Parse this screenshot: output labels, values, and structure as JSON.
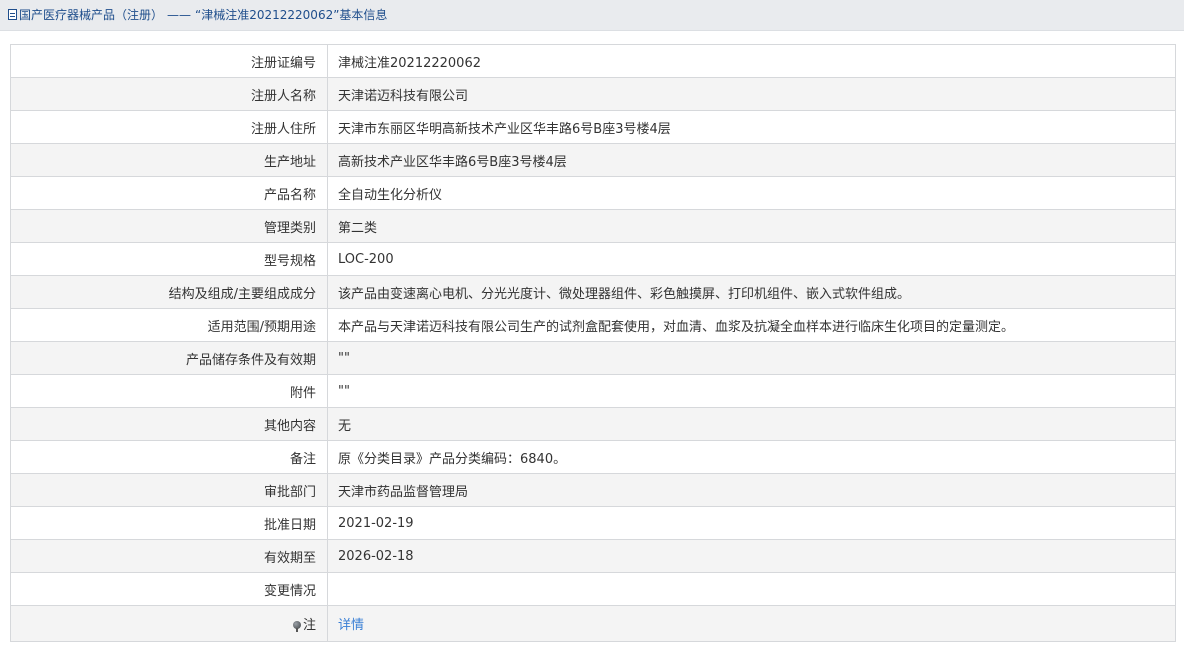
{
  "header": {
    "category": "国产医疗器械产品（注册）",
    "separator": "——",
    "title": "“津械注准20212220062”基本信息"
  },
  "rows": [
    {
      "label": "注册证编号",
      "value": "津械注准20212220062"
    },
    {
      "label": "注册人名称",
      "value": "天津诺迈科技有限公司"
    },
    {
      "label": "注册人住所",
      "value": "天津市东丽区华明高新技术产业区华丰路6号B座3号楼4层"
    },
    {
      "label": "生产地址",
      "value": "高新技术产业区华丰路6号B座3号楼4层"
    },
    {
      "label": "产品名称",
      "value": "全自动生化分析仪"
    },
    {
      "label": "管理类别",
      "value": "第二类"
    },
    {
      "label": "型号规格",
      "value": "LOC-200"
    },
    {
      "label": "结构及组成/主要组成成分",
      "value": "该产品由变速离心电机、分光光度计、微处理器组件、彩色触摸屏、打印机组件、嵌入式软件组成。"
    },
    {
      "label": "适用范围/预期用途",
      "value": "本产品与天津诺迈科技有限公司生产的试剂盒配套使用，对血清、血浆及抗凝全血样本进行临床生化项目的定量测定。"
    },
    {
      "label": "产品储存条件及有效期",
      "value": "\"\""
    },
    {
      "label": "附件",
      "value": "\"\""
    },
    {
      "label": "其他内容",
      "value": "无"
    },
    {
      "label": "备注",
      "value": "原《分类目录》产品分类编码：6840。"
    },
    {
      "label": "审批部门",
      "value": "天津市药品监督管理局"
    },
    {
      "label": "批准日期",
      "value": "2021-02-19"
    },
    {
      "label": "有效期至",
      "value": "2026-02-18"
    },
    {
      "label": "变更情况",
      "value": ""
    }
  ],
  "note": {
    "label": "注",
    "link_text": "详情",
    "icon": "pin-icon"
  },
  "colors": {
    "header_bg": "#e9ebee",
    "header_text": "#1f4e8c",
    "row_alt_bg": "#f4f4f4",
    "border": "#d6d8db",
    "link": "#3a7fd5"
  }
}
